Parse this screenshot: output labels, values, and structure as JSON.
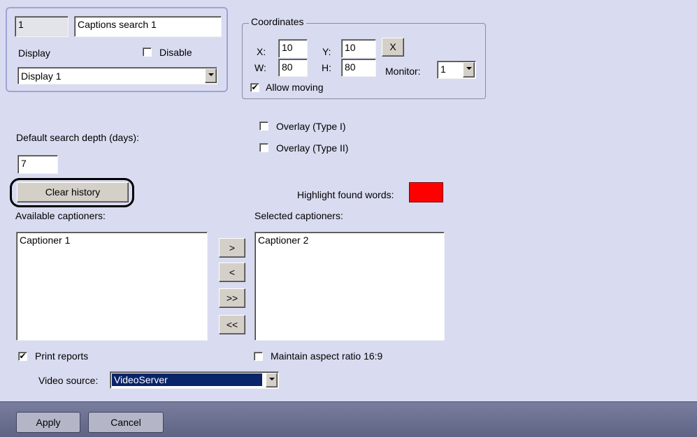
{
  "header": {
    "id_value": "1",
    "name_value": "Captions search 1",
    "display_label": "Display",
    "disable_label": "Disable",
    "display_select": "Display 1"
  },
  "coordinates": {
    "title": "Coordinates",
    "x_label": "X:",
    "x_value": "10",
    "y_label": "Y:",
    "y_value": "10",
    "w_label": "W:",
    "w_value": "80",
    "h_label": "H:",
    "h_value": "80",
    "reset_label": "X",
    "monitor_label": "Monitor:",
    "monitor_value": "1",
    "allow_moving_label": "Allow moving",
    "allow_moving_checked": true
  },
  "overlays": {
    "type1_label": "Overlay (Type I)",
    "type2_label": "Overlay (Type II)"
  },
  "search": {
    "depth_label": "Default search depth (days):",
    "depth_value": "7",
    "clear_history_label": "Clear history",
    "highlight_label": "Highlight found words:",
    "highlight_color": "#ff0000"
  },
  "captioners": {
    "available_label": "Available captioners:",
    "available_items": [
      "Captioner 1"
    ],
    "selected_label": "Selected captioners:",
    "selected_items": [
      "Captioner 2"
    ],
    "move_right": ">",
    "move_left": "<",
    "move_all_right": ">>",
    "move_all_left": "<<"
  },
  "options": {
    "print_reports_label": "Print reports",
    "print_reports_checked": true,
    "aspect_label": "Maintain aspect ratio 16:9",
    "video_source_label": "Video source:",
    "video_source_value": "VideoServer"
  },
  "footer": {
    "apply_label": "Apply",
    "cancel_label": "Cancel"
  },
  "colors": {
    "background": "#d9dbf0",
    "footer_bg": "#666a8c",
    "selection": "#0a246a",
    "highlight_outline": "#000000"
  }
}
